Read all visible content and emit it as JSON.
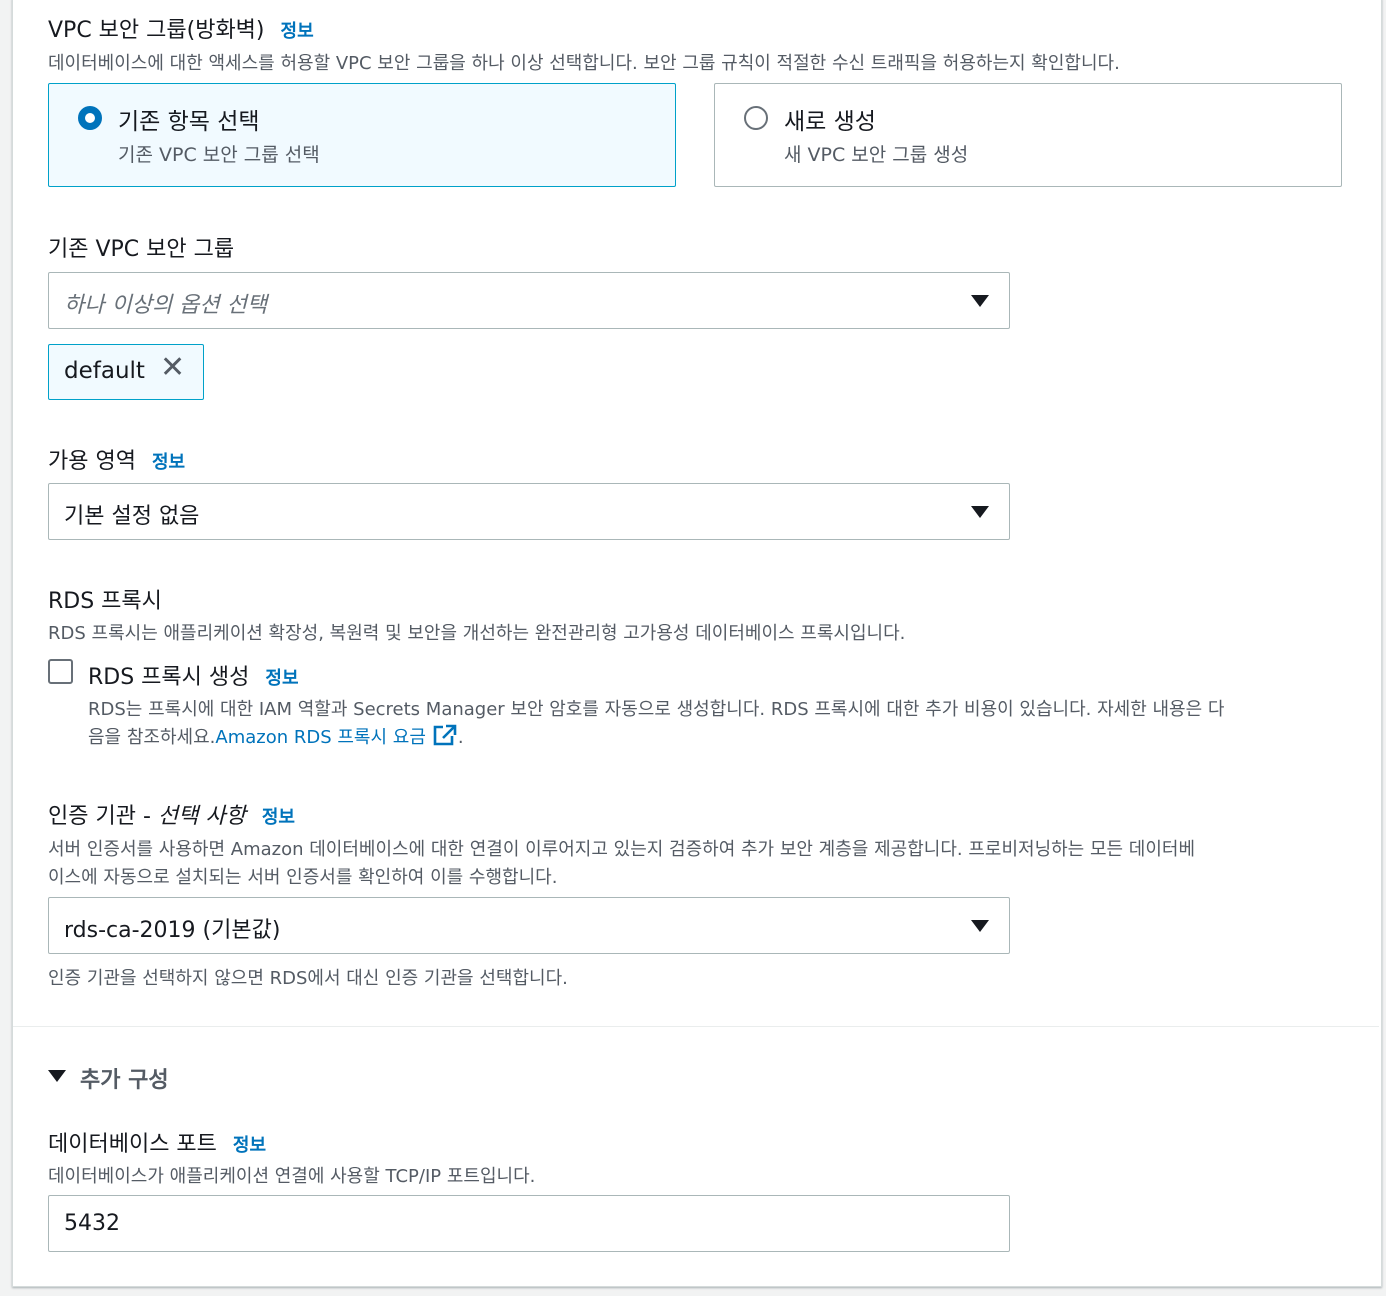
{
  "vpc_security_group": {
    "title": "VPC 보안 그룹(방화벽)",
    "info": "정보",
    "description": "데이터베이스에 대한 액세스를 허용할 VPC 보안 그룹을 하나 이상 선택합니다. 보안 그룹 규칙이 적절한 수신 트래픽을 허용하는지 확인합니다.",
    "options": [
      {
        "title": "기존 항목 선택",
        "subtitle": "기존 VPC 보안 그룹 선택",
        "selected": true
      },
      {
        "title": "새로 생성",
        "subtitle": "새 VPC 보안 그룹 생성",
        "selected": false
      }
    ]
  },
  "existing_vpc_sg": {
    "label": "기존 VPC 보안 그룹",
    "placeholder": "하나 이상의 옵션 선택",
    "tokens": [
      "default"
    ],
    "remove_icon": "close-icon"
  },
  "availability_zone": {
    "label": "가용 영역",
    "info": "정보",
    "value": "기본 설정 없음"
  },
  "rds_proxy": {
    "title": "RDS 프록시",
    "description": "RDS 프록시는 애플리케이션 확장성, 복원력 및 보안을 개선하는 완전관리형 고가용성 데이터베이스 프록시입니다.",
    "checkbox_label": "RDS 프록시 생성",
    "checked": false,
    "info": "정보",
    "help_line1": "RDS는 프록시에 대한 IAM 역할과 Secrets Manager 보안 암호를 자동으로 생성합니다. RDS 프록시에 대한 추가 비용이 있습니다. 자세한 내용은 다",
    "help_line2_prefix": "음을 참조하세요.",
    "help_link": "Amazon RDS 프록시 요금",
    "help_suffix": ".",
    "link_icon": "external-link-icon"
  },
  "certificate_authority": {
    "label": "인증 기관 - ",
    "label_optional": "선택 사항",
    "info": "정보",
    "description_line1": "서버 인증서를 사용하면 Amazon 데이터베이스에 대한 연결이 이루어지고 있는지 검증하여 추가 보안 계층을 제공합니다. 프로비저닝하는 모든 데이터베",
    "description_line2": "이스에 자동으로 설치되는 서버 인증서를 확인하여 이를 수행합니다.",
    "value": "rds-ca-2019 (기본값)",
    "hint": "인증 기관을 선택하지 않으면 RDS에서 대신 인증 기관을 선택합니다."
  },
  "additional_config": {
    "title": "추가 구성",
    "expanded": true
  },
  "db_port": {
    "label": "데이터베이스 포트",
    "info": "정보",
    "description": "데이터베이스가 애플리케이션 연결에 사용할 TCP/IP 포트입니다.",
    "value": "5432"
  },
  "colors": {
    "link": "#0073bb",
    "selected_tile_bg": "#f1faff",
    "selected_border": "#00a1c9",
    "text": "#16191f",
    "secondary_text": "#545b64"
  }
}
